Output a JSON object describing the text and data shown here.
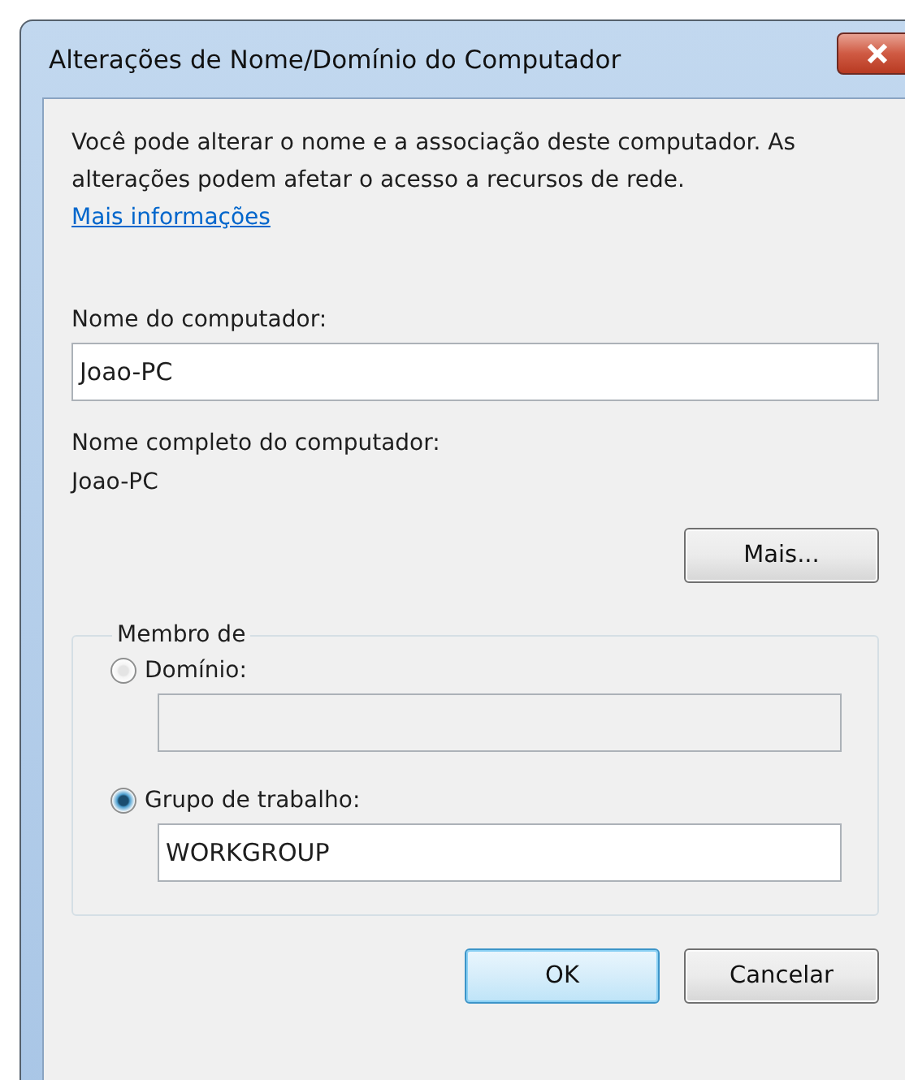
{
  "window": {
    "title": "Alterações de Nome/Domínio do Computador"
  },
  "description": {
    "text": "Você pode alterar o nome e a associação deste computador. As alterações podem afetar o acesso a recursos de rede.",
    "link": "Mais informações"
  },
  "computer_name": {
    "label": "Nome do computador:",
    "value": "Joao-PC"
  },
  "full_name": {
    "label": "Nome completo do computador:",
    "value": "Joao-PC"
  },
  "more_button": "Mais...",
  "member_of": {
    "legend": "Membro de",
    "options": [
      {
        "label": "Domínio:",
        "selected": false
      },
      {
        "label": "Grupo de trabalho:",
        "selected": true,
        "value": "WORKGROUP"
      }
    ]
  },
  "buttons": [
    {
      "label": "OK",
      "default": true
    },
    {
      "label": "Cancelar",
      "default": false
    }
  ]
}
